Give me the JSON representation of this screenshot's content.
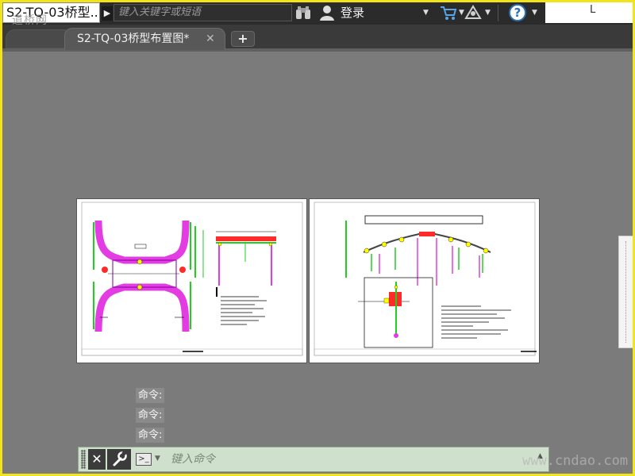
{
  "app": {
    "doc_title": "S2-TQ-03桥型...",
    "watermark_logo": "道桥网",
    "search_placeholder": "键入关键字或短语",
    "login_label": "登录",
    "help_symbol": "?"
  },
  "icons": [
    "search-arrow-icon",
    "binoculars-icon",
    "user-icon",
    "cart-icon",
    "exchange-icon",
    "help-icon",
    "close-icon",
    "wrench-icon",
    "command-prompt-icon"
  ],
  "tabs": {
    "active_title": "S2-TQ-03桥型布置图*",
    "close_symbol": "✕",
    "add_symbol": "+"
  },
  "command_history": [
    "命令:",
    "命令:",
    "命令:"
  ],
  "command_line": {
    "placeholder": "键入命令",
    "close_symbol": "✕",
    "prompt_symbol": ">_"
  },
  "watermark_site": "www.cndao.com",
  "colors": {
    "frame_border": "#f2e41b",
    "canvas_bg": "#7b7b7b",
    "drawing_bg": "#ffffff",
    "green": "#1fd11f",
    "magenta": "#e23ce2",
    "red": "#ff2a2a",
    "yellow": "#ffff00",
    "command_bg": "#cfe1cc"
  }
}
